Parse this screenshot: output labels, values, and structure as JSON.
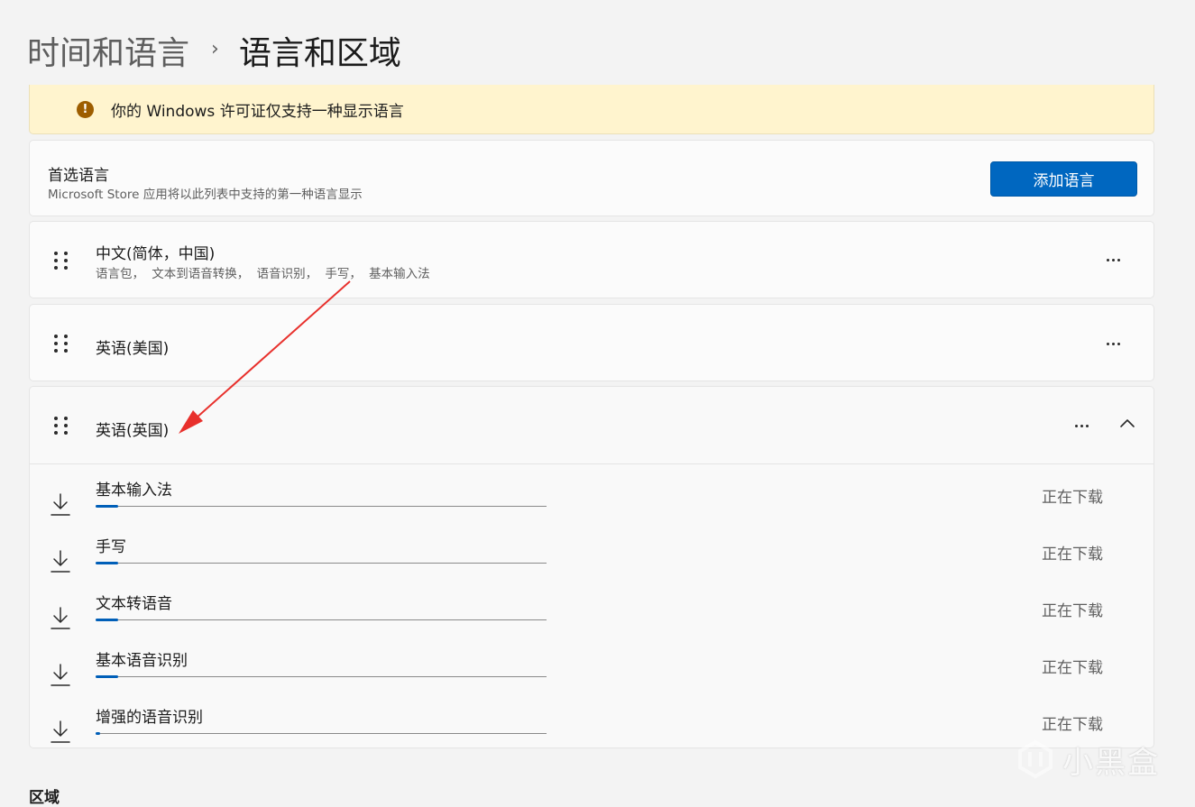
{
  "breadcrumb": {
    "parent": "时间和语言",
    "separator": "›",
    "current": "语言和区域"
  },
  "banner": {
    "icon": "warning-icon",
    "icon_glyph": "!",
    "text": "你的 Windows 许可证仅支持一种显示语言",
    "color": "#fff4ce"
  },
  "preferred": {
    "title": "首选语言",
    "subtitle": "Microsoft Store 应用将以此列表中支持的第一种语言显示",
    "add_button": "添加语言",
    "accent": "#0067c0"
  },
  "languages": [
    {
      "name": "中文(简体，中国)",
      "features": "语言包， 文本到语音转换， 语音识别， 手写， 基本输入法"
    },
    {
      "name": "英语(美国)"
    },
    {
      "name": "英语(英国)",
      "expanded": true,
      "downloads": [
        {
          "name": "基本输入法",
          "status": "正在下载",
          "progress": 5
        },
        {
          "name": "手写",
          "status": "正在下载",
          "progress": 5
        },
        {
          "name": "文本转语音",
          "status": "正在下载",
          "progress": 5
        },
        {
          "name": "基本语音识别",
          "status": "正在下载",
          "progress": 5
        },
        {
          "name": "增强的语音识别",
          "status": "正在下载",
          "progress": 1
        }
      ]
    }
  ],
  "region": {
    "title": "区域"
  },
  "watermark": {
    "text": "小黑盒"
  },
  "annotation": {
    "color": "#e8302c"
  }
}
